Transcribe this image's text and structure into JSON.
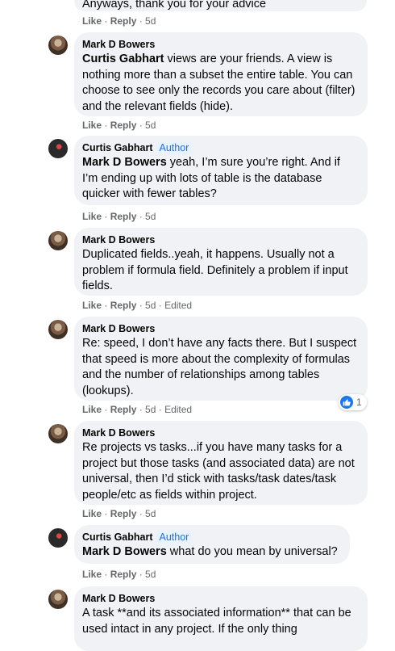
{
  "top": {
    "text": "Anyways, thank you for your advice",
    "like": "Like",
    "reply": "Reply",
    "time": "5d"
  },
  "comments": [
    {
      "author": "Mark D Bowers",
      "mention": "Curtis Gabhart",
      "body": " views are your friends. A view is nothing more than a subset the entire table. You can choose to see only the records you care about (filter) and the relevant fields (hide).",
      "like": "Like",
      "reply": "Reply",
      "time": "5d"
    },
    {
      "author": "Curtis Gabhart",
      "badge": "Author",
      "mention": "Mark D Bowers",
      "body": " yeah, I’m sure you’re right. And if I’m ending up with lots of table is the database quicker with fewer tables?",
      "like": "Like",
      "reply": "Reply",
      "time": "5d"
    },
    {
      "author": "Mark D Bowers",
      "body": "Duplicated fields..yeah, it happens. Usually not a problem if formula field. Definitely a problem if input fields.",
      "like": "Like",
      "reply": "Reply",
      "time": "5d",
      "edited": "Edited"
    },
    {
      "author": "Mark D Bowers",
      "body": "Re: speed, I don’t have any facts there. But I suspect that speed is more about the complexity of formulas and the number of relationships among tables (lookups).",
      "like": "Like",
      "reply": "Reply",
      "time": "5d",
      "edited": "Edited",
      "reaction_count": "1"
    },
    {
      "author": "Mark D Bowers",
      "body": "Re projects vs tasks...if you have many tasks for a project but those tasks (and associated data) are not universal, then I’d stick with tasks/task dates/task people/etc as fields within project.",
      "like": "Like",
      "reply": "Reply",
      "time": "5d"
    },
    {
      "author": "Curtis Gabhart",
      "badge": "Author",
      "mention": "Mark D Bowers",
      "body": " what do you mean by universal?",
      "like": "Like",
      "reply": "Reply",
      "time": "5d"
    },
    {
      "author": "Mark D Bowers",
      "body": "A task **and its associated information** that can be used intact in any project. If the only thing"
    }
  ],
  "colors": {
    "bubble": "#f0f2f5",
    "meta": "#65676b",
    "badge": "#216fdb",
    "like": "#1877f2"
  },
  "icons": {
    "reaction": "thumbs-up-icon"
  }
}
